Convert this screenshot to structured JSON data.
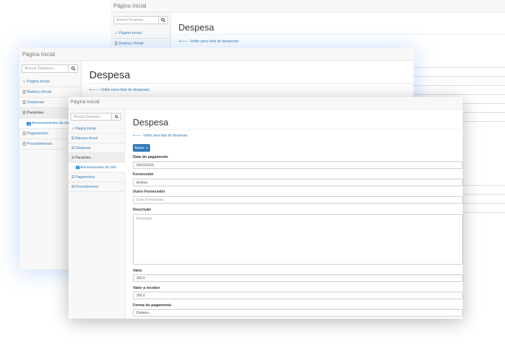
{
  "app": {
    "home": "Página Inicial",
    "search_placeholder": "Buscar Despesa..."
  },
  "icons": {
    "home": "home-icon",
    "list": "list-icon",
    "users": "users-icon",
    "search": "search-icon",
    "back": "arrow-left-icon",
    "caret": "caret-down-icon"
  },
  "sidebar": {
    "items": [
      {
        "label": "Página Inicial",
        "icon": "home-icon"
      },
      {
        "label": "Balanço Anual",
        "icon": "list-icon"
      },
      {
        "label": "Despesas",
        "icon": "list-icon"
      },
      {
        "label": "Pacientes",
        "icon": "list-icon"
      },
      {
        "label": "Aniversariantes do mês",
        "icon": "users-icon"
      },
      {
        "label": "Pagamentos",
        "icon": "list-icon"
      },
      {
        "label": "Procedimentos",
        "icon": "list-icon"
      }
    ],
    "middle_sub_label": "Aniversariantes do mê"
  },
  "page": {
    "title": "Despesa",
    "back_link": "Voltar para lista de despesas",
    "actions_button": "Ações"
  },
  "form": {
    "payment_date_label": "Data do pagamento",
    "payment_date_value": "09/03/2018",
    "supplier_label": "Fornecedor",
    "supplier_value": "Andrea",
    "other_supplier_label": "Outro Fornecedor",
    "other_supplier_placeholder": "Outro Fornecedor",
    "description_label": "Descrição",
    "description_placeholder": "Descrição",
    "value_label": "Valor",
    "value_value": "300.0",
    "receivable_label": "Valor a receber",
    "receivable_value": "300.0",
    "payment_method_label": "Forma de pagamento",
    "payment_method_value": "Dinheiro"
  },
  "colors": {
    "link": "#337ab7",
    "primary": "#337ab7",
    "sidebar_bg": "#f8f8f8",
    "active_bg": "#eeeeee"
  }
}
